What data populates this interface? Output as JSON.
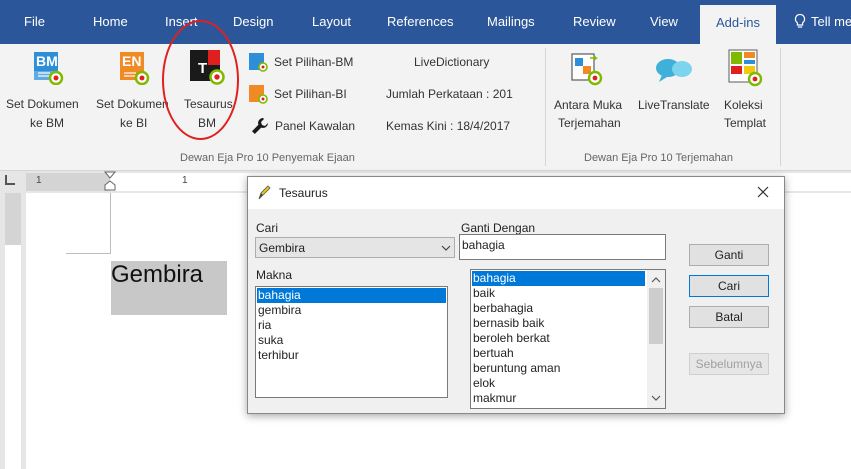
{
  "ribbon": {
    "tabs": [
      "File",
      "Home",
      "Insert",
      "Design",
      "Layout",
      "References",
      "Mailings",
      "Review",
      "View"
    ],
    "active_tab": "Add-ins",
    "tell_me": "Tell me",
    "set_dokumen_bm": [
      "Set Dokumen",
      "ke BM"
    ],
    "set_dokumen_bi": [
      "Set Dokumen",
      "ke BI"
    ],
    "tesaurus_bm": [
      "Tesaurus",
      "BM"
    ],
    "set_pilihan_bm": "Set Pilihan-BM",
    "set_pilihan_bi": "Set Pilihan-BI",
    "panel_kawalan": "Panel Kawalan",
    "live_dictionary": "LiveDictionary",
    "jumlah_perkataan": "Jumlah Perkataan : 201",
    "kemas_kini": "Kemas Kini : 18/4/2017",
    "group1_label": "Dewan Eja Pro 10 Penyemak Ejaan",
    "antara_muka": [
      "Antara Muka",
      "Terjemahan"
    ],
    "live_translate": "LiveTranslate",
    "koleksi_templat": [
      "Koleksi",
      "Templat"
    ],
    "group2_label": "Dewan Eja Pro 10 Terjemahan",
    "icon_bm": "BM",
    "icon_en": "EN",
    "icon_t": "T",
    "highlight_color": "#e0201f",
    "accent_color": "#2b579a"
  },
  "ruler": {
    "marks": [
      "1",
      "1"
    ]
  },
  "document": {
    "text": "Gembira"
  },
  "dialog": {
    "title": "Tesaurus",
    "cari_label": "Cari",
    "cari_value": "Gembira",
    "ganti_dengan_label": "Ganti Dengan",
    "ganti_dengan_value": "bahagia",
    "makna_label": "Makna",
    "makna_items": [
      "bahagia",
      "gembira",
      "ria",
      "suka",
      "terhibur"
    ],
    "makna_selected": 0,
    "synonyms": [
      "bahagia",
      "baik",
      "berbahagia",
      "bernasib baik",
      "beroleh berkat",
      "bertuah",
      "beruntung aman",
      "elok",
      "makmur"
    ],
    "synonyms_selected": 0,
    "buttons": {
      "ganti": "Ganti",
      "cari": "Cari",
      "batal": "Batal",
      "sebelumnya": "Sebelumnya"
    }
  }
}
